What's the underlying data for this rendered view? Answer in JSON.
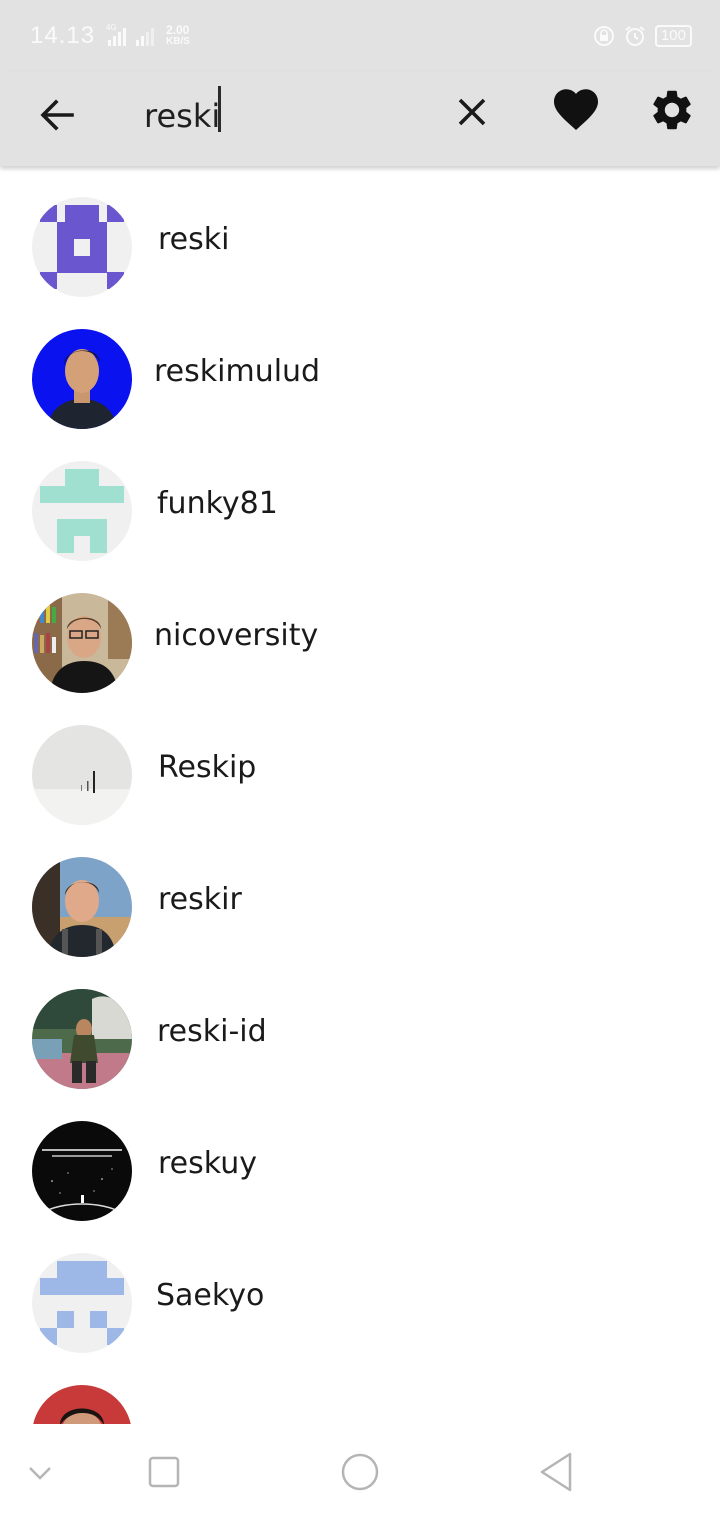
{
  "status": {
    "time": "14.13",
    "net_speed": "2.00",
    "net_unit": "KB/S",
    "network_type": "4G",
    "battery": "100"
  },
  "search": {
    "query": "reski"
  },
  "icons": {
    "back": "arrow-left-icon",
    "clear": "close-icon",
    "favorite": "heart-icon",
    "settings": "gear-icon"
  },
  "colors": {
    "app_bar": "#e2e2e2",
    "identicon_purple": "#6a57d0",
    "identicon_teal": "#9fe0d0",
    "identicon_blue": "#9db8e6"
  },
  "results": [
    {
      "username": "reski"
    },
    {
      "username": "reskimulud"
    },
    {
      "username": "funky81"
    },
    {
      "username": "nicoversity"
    },
    {
      "username": "Reskip"
    },
    {
      "username": "reskir"
    },
    {
      "username": "reski-id"
    },
    {
      "username": "reskuy"
    },
    {
      "username": "Saekyo"
    }
  ]
}
